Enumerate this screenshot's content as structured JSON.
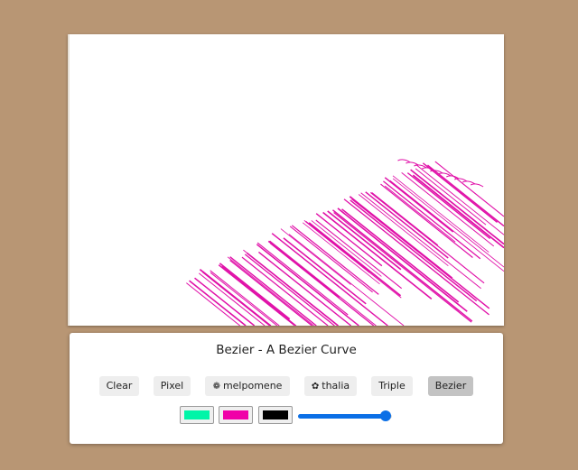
{
  "panel": {
    "title": "Bezier - A Bezier Curve"
  },
  "toolbar": {
    "buttons": [
      {
        "label": "Clear",
        "icon": "",
        "active": false
      },
      {
        "label": "Pixel",
        "icon": "",
        "active": false
      },
      {
        "label": "melpomene",
        "icon": "gear-flower-icon",
        "active": false
      },
      {
        "label": "thalia",
        "icon": "flower-icon",
        "active": false
      },
      {
        "label": "Triple",
        "icon": "",
        "active": false
      },
      {
        "label": "Bezier",
        "icon": "",
        "active": true
      }
    ]
  },
  "colors": {
    "swatches": [
      "#00f5a8",
      "#f000a8",
      "#000000"
    ],
    "stroke": "#e010a8",
    "slider_accent": "#0b6fe6"
  },
  "slider": {
    "value_fraction": 0.93
  }
}
